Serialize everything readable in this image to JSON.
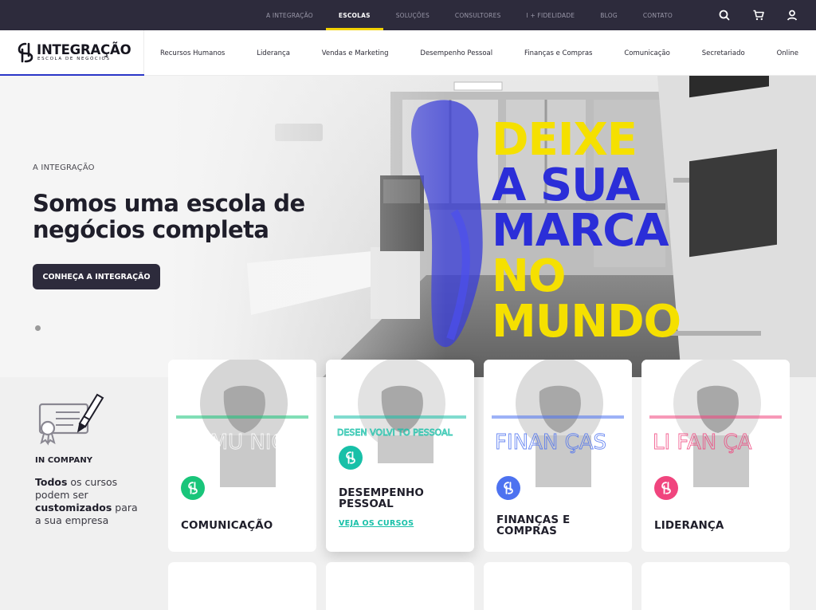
{
  "topbar": {
    "items": [
      {
        "label": "A INTEGRAÇÃO",
        "active": false
      },
      {
        "label": "ESCOLAS",
        "active": true
      },
      {
        "label": "SOLUÇÕES",
        "active": false
      },
      {
        "label": "CONSULTORES",
        "active": false
      },
      {
        "label": "I + FIDELIDADE",
        "active": false
      },
      {
        "label": "BLOG",
        "active": false
      },
      {
        "label": "CONTATO",
        "active": false
      }
    ],
    "icons": [
      "search-icon",
      "cart-icon",
      "user-icon"
    ],
    "accent": "#f2d200",
    "background": "#2d2b3c"
  },
  "logo": {
    "title": "INTEGRAÇÃO",
    "subtitle": "ESCOLA DE NEGÓCIOS"
  },
  "nav": {
    "items": [
      "Recursos Humanos",
      "Liderança",
      "Vendas e Marketing",
      "Desempenho Pessoal",
      "Finanças e Compras",
      "Comunicação",
      "Secretariado",
      "Online"
    ],
    "underline_color": "#2a36c8"
  },
  "hero": {
    "kicker": "A INTEGRAÇÃO",
    "title": "Somos uma escola de negócios completa",
    "button": "CONHEÇA A INTEGRAÇÃO",
    "slogan": [
      "DEIXE",
      "A SUA",
      "MARCA",
      "NO",
      "MUNDO"
    ],
    "slogan_colors": [
      "#f5e000",
      "#2b2ed8",
      "#2b2ed8",
      "#f5e000",
      "#f5e000"
    ]
  },
  "incompany": {
    "label": "IN COMPANY",
    "text_parts": [
      {
        "text": "Todos",
        "bold": true
      },
      {
        "text": " os cursos podem ser ",
        "bold": false
      },
      {
        "text": "customizados",
        "bold": true
      },
      {
        "text": " para a sua empresa",
        "bold": false
      }
    ]
  },
  "cards": [
    {
      "title": "COMUNICAÇÃO",
      "link": "",
      "badge_color": "#19c57a",
      "art_word": "COMU NICAÇÃO",
      "art_word_color": "#ffffff"
    },
    {
      "title": "DESEMPENHO PESSOAL",
      "link": "VEJA OS CURSOS",
      "badge_color": "#18c0a8",
      "art_word": "DESEN VOLVI TO PESSOAL",
      "art_word_color": "#18c0a8"
    },
    {
      "title": "FINANÇAS E COMPRAS",
      "link": "",
      "badge_color": "#4d72f0",
      "art_word": "FINAN ÇAS",
      "art_word_color": "#4d72f0"
    },
    {
      "title": "LIDERANÇA",
      "link": "",
      "badge_color": "#f0457e",
      "art_word": "LI FAN ÇA",
      "art_word_color": "#f0457e"
    }
  ]
}
